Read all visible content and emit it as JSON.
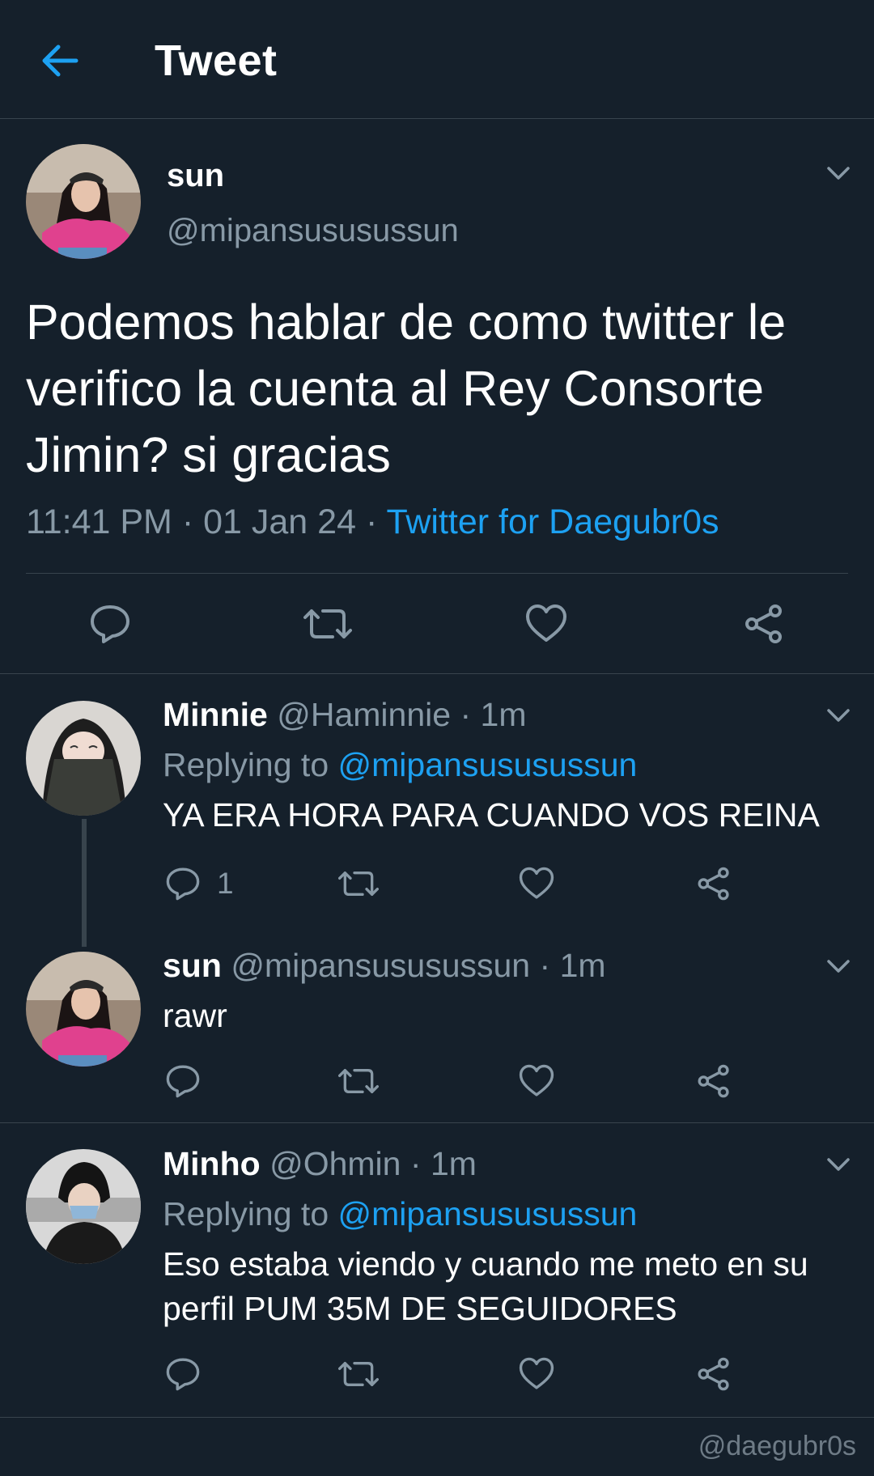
{
  "header": {
    "title": "Tweet"
  },
  "main_tweet": {
    "name": "sun",
    "handle": "@mipansususussun",
    "text": "Podemos hablar de como twitter le verifico la cuenta al Rey Consorte Jimin? si gracias",
    "time": "11:41 PM",
    "date": "01 Jan 24",
    "separator": "·",
    "source": "Twitter for Daegubr0s"
  },
  "replies": [
    {
      "name": "Minnie",
      "handle": "@Haminnie",
      "time": "1m",
      "replying_label": "Replying to",
      "replying_to": "@mipansususussun",
      "text": "YA ERA HORA PARA CUANDO VOS REINA",
      "reply_count": "1"
    },
    {
      "name": "sun",
      "handle": "@mipansususussun",
      "time": "1m",
      "text": "rawr"
    },
    {
      "name": "Minho",
      "handle": "@Ohmin",
      "time": "1m",
      "replying_label": "Replying to",
      "replying_to": "@mipansususussun",
      "text": "Eso estaba viendo y cuando me meto en su perfil PUM 35M DE SEGUIDORES"
    }
  ],
  "watermark": "@daegubr0s",
  "colors": {
    "background": "#15202b",
    "accent": "#1da1f2",
    "muted": "#8899a6",
    "divider": "#38444d"
  },
  "icons": [
    "back-arrow-icon",
    "chevron-down-icon",
    "reply-icon",
    "retweet-icon",
    "like-icon",
    "share-icon"
  ]
}
